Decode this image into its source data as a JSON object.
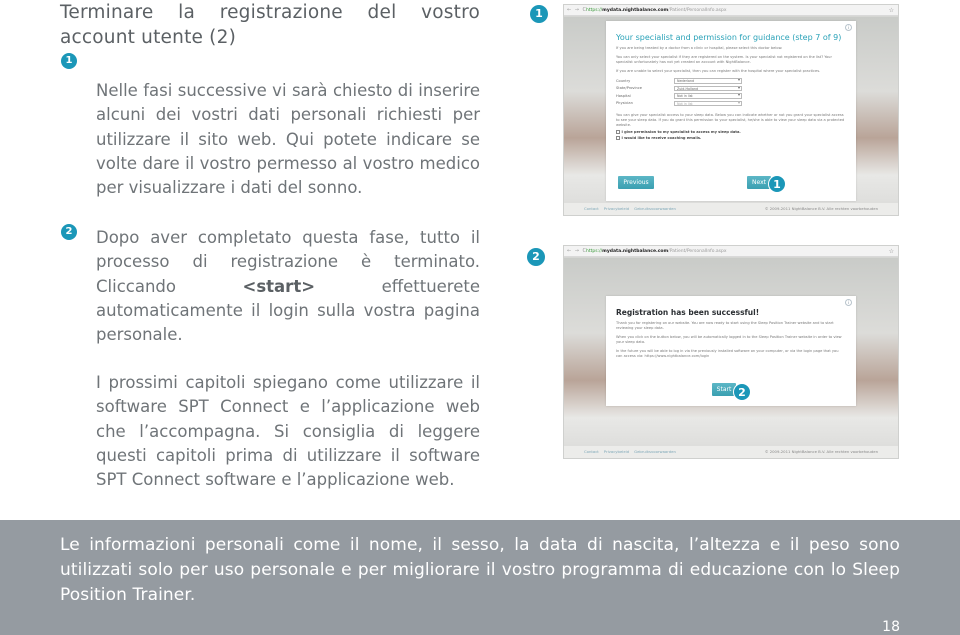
{
  "heading": "Terminare la registrazione del vostro account utente (2)",
  "badges": {
    "one": "1",
    "two": "2"
  },
  "step1_text": "Nelle fasi successive vi sarà chiesto di inserire alcuni dei vostri dati personali richiesti per utilizzare il sito web. Qui potete indicare se volte dare il vostro permesso al vostro medico per visualizzare i dati del sonno.",
  "step2_text_before": "Dopo aver completato questa fase, tutto il processo di registrazione è terminato. Cliccando ",
  "step2_bold": "<start>",
  "step2_text_after": " effettuerete automaticamente il login sulla vostra pagina personale.",
  "chapters_text": "I prossimi capitoli spiegano come utilizzare il software SPT Connect e l’applicazione web che l’accompagna. Si consiglia di leggere questi capitoli prima di utilizzare il software SPT Connect software e l’applicazione web.",
  "screenshot1": {
    "nav": "← → C",
    "url_scheme": "https://",
    "url_host": "mydata.nightbalance.com",
    "url_path": "/Patient/PersonalInfo.aspx",
    "star": "☆",
    "info": "i",
    "title": "Your specialist and permission for guidance (step 7 of 9)",
    "p1": "If you are being treated by a doctor from a clinic or hospital, please select this doctor below.",
    "p2": "You can only select your specialist if they are registered on the system. Is your specialist not registered on the list? Your specialist unfortunately has not yet created an account with NightBalance.",
    "p3": "If you are unable to select your specialist, then you can register with the hospital where your specialist practices.",
    "fields": [
      {
        "label": "Country",
        "value": "Nederland"
      },
      {
        "label": "State/Province",
        "value": "Zuid-Holland"
      },
      {
        "label": "Hospital",
        "value": "Not in list"
      },
      {
        "label": "Physician",
        "value": "Not in list"
      }
    ],
    "p4": "You can give your specialist access to your sleep data. Below you can indicate whether or not you grant your specialist access to see your sleep data. If you do grant this permission to your specialist, he/she is able to view your sleep data via a protected website.",
    "checks": [
      "I give permission to my specialist to access my sleep data.",
      "I would like to receive coaching emails."
    ],
    "previous_label": "Previous",
    "next_label": "Next",
    "footer_links": [
      "Contact",
      "Privacybeleid",
      "Gebruiksvoorwaarden"
    ],
    "footer_copy": "© 2009-2011 NightBalance B.V. Alle rechten voorbehouden"
  },
  "screenshot2": {
    "nav": "← → C",
    "url_scheme": "https://",
    "url_host": "mydata.nightbalance.com",
    "url_path": "/Patient/PersonalInfo.aspx",
    "star": "☆",
    "info": "i",
    "title": "Registration has been successful!",
    "p1": "Thank you for registering on our website. You are now ready to start using the Sleep Position Trainer website and to start reviewing your sleep data.",
    "p2": "When you click on the button below, you will be automatically logged in to the Sleep Position Trainer website in order to view your sleep data.",
    "p3": "In the future you will be able to log in via the previously installed software on your computer, or via the login page that you can access via: https://www.nightbalance.com/login",
    "start_label": "Start",
    "footer_links": [
      "Contact",
      "Privacybeleid",
      "Gebruiksvoorwaarden"
    ],
    "footer_copy": "© 2009-2011 NightBalance B.V. Alle rechten voorbehouden"
  },
  "banner_text": "Le informazioni personali come il nome, il sesso, la data di nascita, l’altezza e il peso sono utilizzati solo per uso personale e per migliorare il vostro programma di educazione con lo Sleep Position Trainer.",
  "page_number": "18",
  "colors": {
    "accent": "#1b97b8",
    "banner": "#959ba1",
    "text": "#6f7478"
  }
}
